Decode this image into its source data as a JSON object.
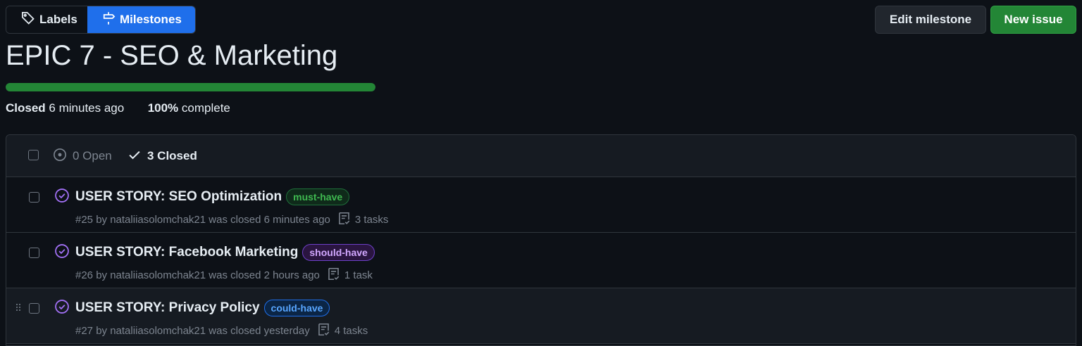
{
  "nav": {
    "labels_label": "Labels",
    "milestones_label": "Milestones"
  },
  "actions": {
    "edit_label": "Edit milestone",
    "new_issue_label": "New issue"
  },
  "milestone": {
    "title": "EPIC 7 - SEO & Marketing",
    "progress_percent": 100,
    "status_word": "Closed",
    "status_time": "6 minutes ago",
    "percent_text": "100%",
    "complete_text": "complete"
  },
  "list": {
    "open_label": "0 Open",
    "closed_label": "3 Closed",
    "issues": [
      {
        "title": "USER STORY: SEO Optimization",
        "label": "must-have",
        "meta": "#25 by nataliiasolomchak21 was closed 6 minutes ago",
        "tasks": "3 tasks"
      },
      {
        "title": "USER STORY: Facebook Marketing",
        "label": "should-have",
        "meta": "#26 by nataliiasolomchak21 was closed 2 hours ago",
        "tasks": "1 task"
      },
      {
        "title": "USER STORY: Privacy Policy",
        "label": "could-have",
        "meta": "#27 by nataliiasolomchak21 was closed yesterday",
        "tasks": "4 tasks"
      }
    ]
  },
  "colors": {
    "accent_blue": "#1f6feb",
    "success_green": "#238636",
    "closed_purple": "#a371f7",
    "background": "#0d1117"
  },
  "icons": {
    "labels": "tag-icon",
    "milestones": "milestone-icon",
    "open": "issue-open-icon",
    "closed": "check-icon",
    "issue_status": "issue-closed-icon",
    "tasks": "tasklist-icon",
    "drag": "drag-handle-icon"
  }
}
